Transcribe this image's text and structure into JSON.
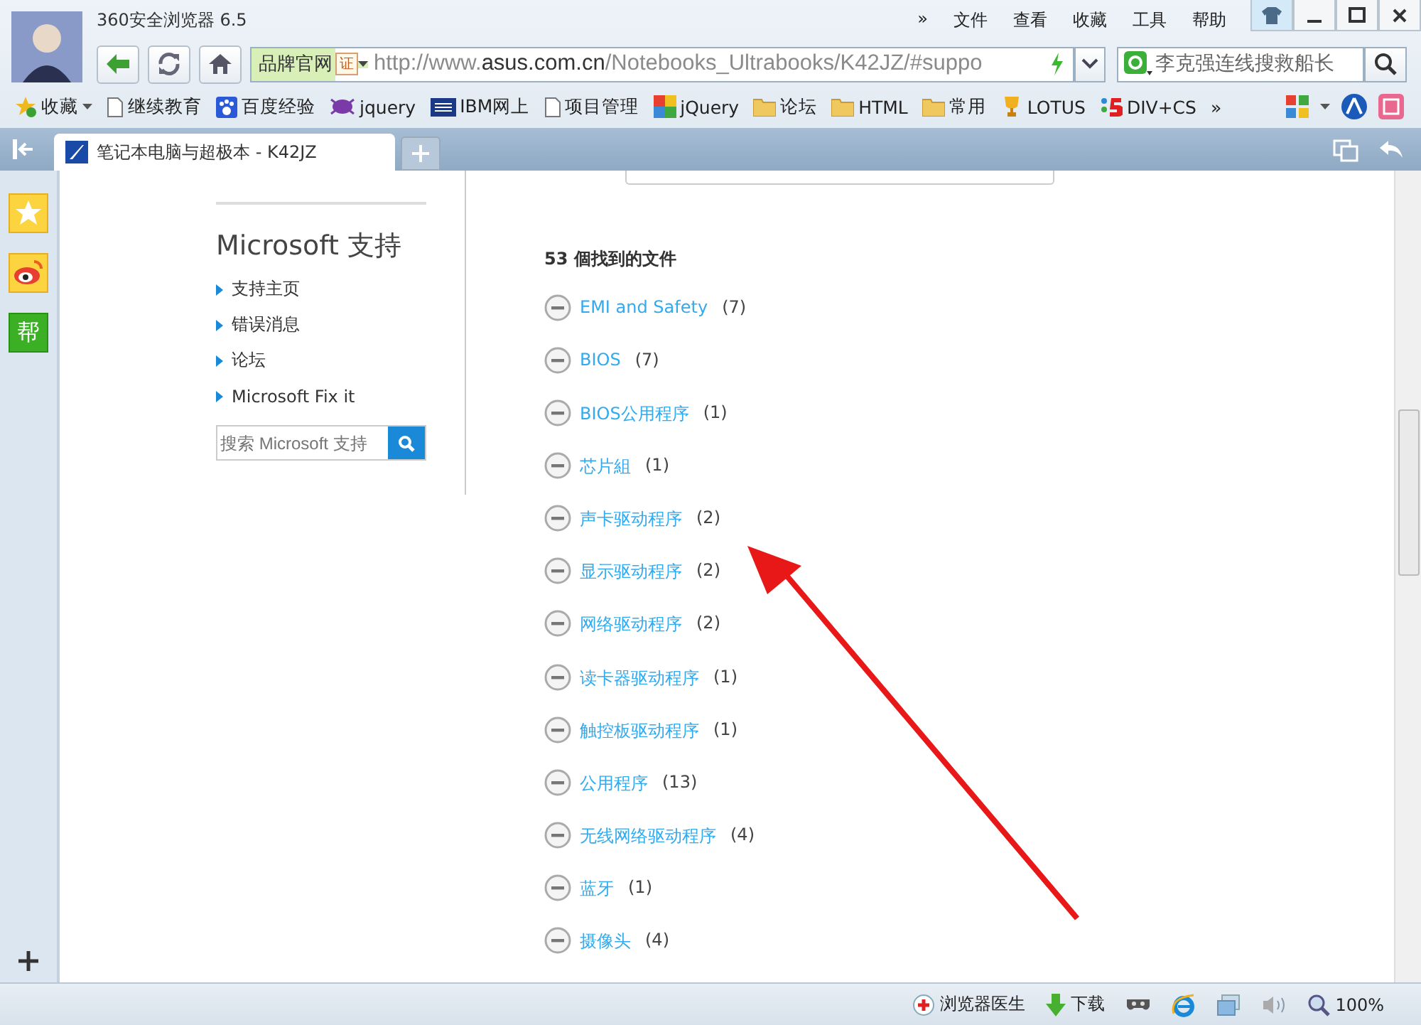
{
  "window": {
    "title": "360安全浏览器 6.5",
    "menu": [
      "»",
      "文件",
      "查看",
      "收藏",
      "工具",
      "帮助"
    ]
  },
  "address_bar": {
    "brand_label": "品牌官网",
    "badge": "证",
    "url_prefix": "http://www.",
    "url_host": "asus.com.cn",
    "url_path": "/Notebooks_Ultrabooks/K42JZ/#suppo"
  },
  "search": {
    "value": "李克强连线搜救船长"
  },
  "bookmarks": [
    {
      "kind": "star",
      "label": "收藏",
      "menu": true
    },
    {
      "kind": "page",
      "label": "继续教育",
      "menu": false
    },
    {
      "kind": "paw",
      "label": "百度经验",
      "menu": false
    },
    {
      "kind": "bug",
      "label": "jquery",
      "menu": false
    },
    {
      "kind": "ibm",
      "label": "IBM网上",
      "menu": false
    },
    {
      "kind": "page",
      "label": "项目管理",
      "menu": false
    },
    {
      "kind": "jq",
      "label": "jQuery",
      "menu": false
    },
    {
      "kind": "folder",
      "label": "论坛",
      "menu": false
    },
    {
      "kind": "folder",
      "label": "HTML",
      "menu": false
    },
    {
      "kind": "folder",
      "label": "常用",
      "menu": false
    },
    {
      "kind": "trophy",
      "label": "LOTUS",
      "menu": false
    },
    {
      "kind": "five",
      "label": "DIV+CS",
      "menu": false
    }
  ],
  "bookmarks_more": "»",
  "tabs": [
    {
      "title": "笔记本电脑与超极本 - K42JZ",
      "selected": true
    }
  ],
  "sidebar": {
    "items": [
      {
        "kind": "star"
      },
      {
        "kind": "weibo"
      },
      {
        "kind": "text",
        "label": "帮"
      }
    ]
  },
  "support": {
    "title": "Microsoft 支持",
    "links": [
      "支持主页",
      "错误消息",
      "论坛",
      "Microsoft Fix it"
    ],
    "search_placeholder": "搜索 Microsoft 支持"
  },
  "files": {
    "heading": "53 個找到的文件",
    "categories": [
      {
        "name": "EMI and Safety",
        "count": "(7)"
      },
      {
        "name": "BIOS",
        "count": "(7)"
      },
      {
        "name": "BIOS公用程序",
        "count": "(1)"
      },
      {
        "name": "芯片組",
        "count": "(1)"
      },
      {
        "name": "声卡驱动程序",
        "count": "(2)"
      },
      {
        "name": "显示驱动程序",
        "count": "(2)"
      },
      {
        "name": "网络驱动程序",
        "count": "(2)"
      },
      {
        "name": "读卡器驱动程序",
        "count": "(1)"
      },
      {
        "name": "触控板驱动程序",
        "count": "(1)"
      },
      {
        "name": "公用程序",
        "count": "(13)"
      },
      {
        "name": "无线网络驱动程序",
        "count": "(4)"
      },
      {
        "name": "蓝牙",
        "count": "(1)"
      },
      {
        "name": "摄像头",
        "count": "(4)"
      }
    ]
  },
  "status_bar": {
    "doctor": "浏览器医生",
    "download": "下载",
    "zoom": "100%"
  }
}
